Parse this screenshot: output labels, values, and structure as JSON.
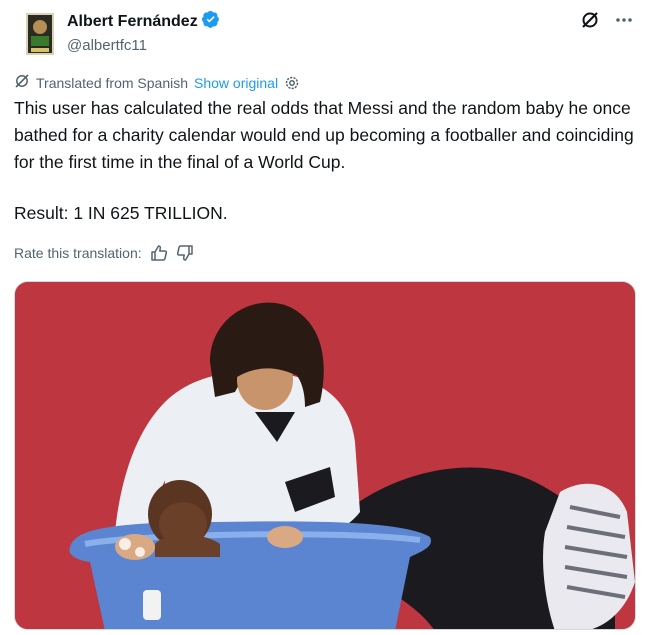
{
  "author": {
    "display_name": "Albert Fernández",
    "handle": "@albertfc11"
  },
  "icons": {
    "verified": "verified-badge-icon",
    "grok": "grok-icon",
    "more": "more-icon",
    "translate": "translate-icon",
    "settings": "gear-icon",
    "thumbs_up": "thumbs-up-icon",
    "thumbs_down": "thumbs-down-icon"
  },
  "translation": {
    "label": "Translated from Spanish",
    "show_original": "Show original"
  },
  "tweet": {
    "text": "This user has calculated the real odds that Messi and the random baby he once bathed for a charity calendar would end up becoming a footballer and coinciding for the first time in the final of a World Cup.",
    "result": "Result: 1 IN 625 TRILLION."
  },
  "rate": {
    "label": "Rate this translation:"
  },
  "colors": {
    "link": "#1d9bf0",
    "verified": "#1d9bf0",
    "secondary_text": "#536471",
    "photo_background": "#c63a44"
  }
}
